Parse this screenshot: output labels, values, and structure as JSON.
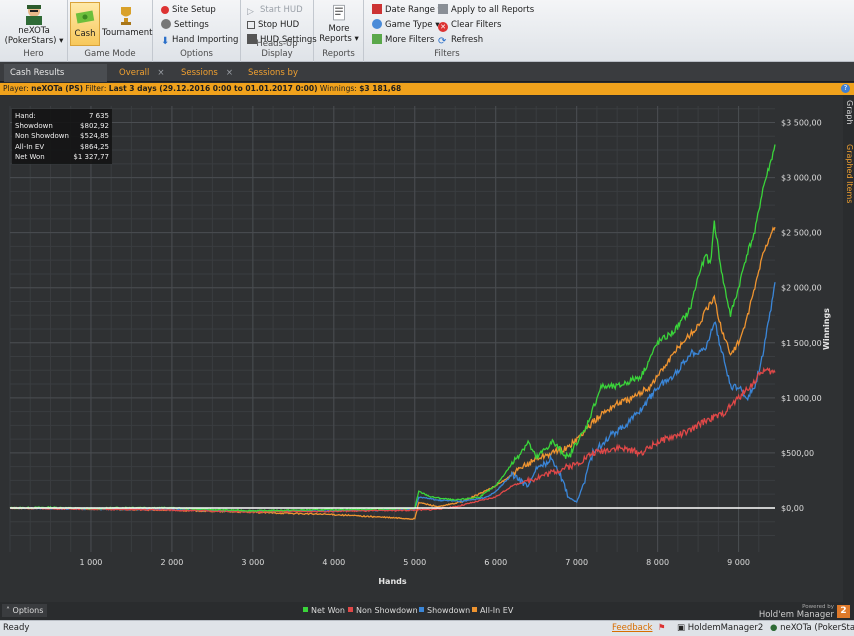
{
  "ribbon": {
    "hero": {
      "name": "neXOTa",
      "site": "(PokerStars)",
      "group_label": "Hero"
    },
    "game_mode": {
      "cash": "Cash",
      "tournament": "Tournament",
      "group_label": "Game Mode"
    },
    "options": {
      "site_setup": "Site Setup",
      "settings": "Settings",
      "hand_importing": "Hand Importing",
      "group_label": "Options"
    },
    "hud": {
      "start": "Start HUD",
      "stop": "Stop HUD",
      "settings": "HUD Settings",
      "group_label": "Heads-Up Display"
    },
    "reports": {
      "more_line1": "More",
      "more_line2": "Reports",
      "group_label": "Reports"
    },
    "filters": {
      "date_range": "Date Range",
      "game_type": "Game Type",
      "more_filters": "More Filters",
      "apply_all": "Apply to all Reports",
      "clear": "Clear Filters",
      "refresh": "Refresh",
      "group_label": "Filters"
    }
  },
  "tabs": [
    {
      "label": "Cash Results Graph"
    },
    {
      "label": "Overall"
    },
    {
      "label": "Sessions"
    },
    {
      "label": "Sessions by Day"
    }
  ],
  "filter_bar": {
    "player_label": "Player:",
    "player": "neXOTa (PS)",
    "filter_label": "Filter:",
    "filter": "Last 3 days (29.12.2016 0:00 to 01.01.2017 0:00)",
    "winnings_label": "Winnings:",
    "winnings": "$3 181,68",
    "help": "?"
  },
  "side_tabs": {
    "graph": "Graph",
    "graphed_items": "Graphed Items"
  },
  "stats": [
    {
      "label": "Hand:",
      "value": "7 635"
    },
    {
      "label": "Showdown",
      "value": "$802,92"
    },
    {
      "label": "Non Showdown",
      "value": "$524,85"
    },
    {
      "label": "All-In EV",
      "value": "$864,25"
    },
    {
      "label": "Net Won",
      "value": "$1 327,77"
    }
  ],
  "chart_data": {
    "type": "line",
    "xlabel": "Hands",
    "ylabel": "Winnings",
    "xlim": [
      0,
      9450
    ],
    "ylim": [
      -400,
      3650
    ],
    "x_ticks": [
      "1 000",
      "2 000",
      "3 000",
      "4 000",
      "5 000",
      "6 000",
      "7 000",
      "8 000",
      "9 000"
    ],
    "y_ticks": [
      "$0,00",
      "$500,00",
      "$1 000,00",
      "$1 500,00",
      "$2 000,00",
      "$2 500,00",
      "$3 000,00",
      "$3 500,00"
    ],
    "grid": true,
    "legend_position": "bottom",
    "series": [
      {
        "name": "Net Won",
        "color": "#3ad43a",
        "points": [
          [
            0,
            0
          ],
          [
            500,
            5
          ],
          [
            1000,
            -5
          ],
          [
            1500,
            5
          ],
          [
            2000,
            0
          ],
          [
            2500,
            -15
          ],
          [
            3000,
            -25
          ],
          [
            3500,
            -20
          ],
          [
            4000,
            -15
          ],
          [
            4500,
            -10
          ],
          [
            5000,
            -5
          ],
          [
            5050,
            150
          ],
          [
            5200,
            100
          ],
          [
            5500,
            70
          ],
          [
            5800,
            100
          ],
          [
            6000,
            200
          ],
          [
            6200,
            400
          ],
          [
            6400,
            600
          ],
          [
            6500,
            450
          ],
          [
            6700,
            600
          ],
          [
            6900,
            450
          ],
          [
            7000,
            600
          ],
          [
            7100,
            700
          ],
          [
            7200,
            900
          ],
          [
            7300,
            1100
          ],
          [
            7500,
            1100
          ],
          [
            7800,
            1200
          ],
          [
            8000,
            1500
          ],
          [
            8200,
            1600
          ],
          [
            8400,
            1800
          ],
          [
            8500,
            2100
          ],
          [
            8600,
            2300
          ],
          [
            8650,
            2200
          ],
          [
            8700,
            2600
          ],
          [
            8800,
            2100
          ],
          [
            8900,
            1750
          ],
          [
            9000,
            2000
          ],
          [
            9100,
            2300
          ],
          [
            9200,
            2500
          ],
          [
            9300,
            2900
          ],
          [
            9400,
            3150
          ],
          [
            9450,
            3300
          ]
        ]
      },
      {
        "name": "Non Showdown",
        "color": "#e04848",
        "points": [
          [
            0,
            0
          ],
          [
            1000,
            -10
          ],
          [
            2000,
            -20
          ],
          [
            3000,
            -35
          ],
          [
            4000,
            -30
          ],
          [
            5000,
            -20
          ],
          [
            5200,
            -15
          ],
          [
            5500,
            10
          ],
          [
            6000,
            100
          ],
          [
            6200,
            200
          ],
          [
            6400,
            250
          ],
          [
            6600,
            300
          ],
          [
            6800,
            350
          ],
          [
            7000,
            400
          ],
          [
            7200,
            500
          ],
          [
            7500,
            550
          ],
          [
            7800,
            500
          ],
          [
            8000,
            600
          ],
          [
            8200,
            650
          ],
          [
            8400,
            700
          ],
          [
            8600,
            800
          ],
          [
            8800,
            850
          ],
          [
            9000,
            1000
          ],
          [
            9200,
            1150
          ],
          [
            9300,
            1250
          ],
          [
            9450,
            1230
          ]
        ]
      },
      {
        "name": "Showdown",
        "color": "#3a86d8",
        "points": [
          [
            0,
            0
          ],
          [
            1000,
            -10
          ],
          [
            2000,
            -15
          ],
          [
            3000,
            -30
          ],
          [
            4000,
            -25
          ],
          [
            5000,
            -15
          ],
          [
            5050,
            100
          ],
          [
            5300,
            70
          ],
          [
            5600,
            60
          ],
          [
            5900,
            100
          ],
          [
            6000,
            150
          ],
          [
            6200,
            300
          ],
          [
            6400,
            200
          ],
          [
            6500,
            350
          ],
          [
            6700,
            450
          ],
          [
            6800,
            300
          ],
          [
            6900,
            100
          ],
          [
            7000,
            50
          ],
          [
            7100,
            250
          ],
          [
            7200,
            500
          ],
          [
            7400,
            650
          ],
          [
            7600,
            750
          ],
          [
            7800,
            900
          ],
          [
            8000,
            1100
          ],
          [
            8200,
            1200
          ],
          [
            8400,
            1400
          ],
          [
            8600,
            1450
          ],
          [
            8700,
            1700
          ],
          [
            8800,
            1400
          ],
          [
            8900,
            1100
          ],
          [
            9000,
            1100
          ],
          [
            9100,
            1000
          ],
          [
            9200,
            1100
          ],
          [
            9300,
            1400
          ],
          [
            9400,
            1800
          ],
          [
            9450,
            2050
          ]
        ]
      },
      {
        "name": "All-In EV",
        "color": "#ef9430",
        "points": [
          [
            0,
            0
          ],
          [
            1000,
            -10
          ],
          [
            2000,
            -20
          ],
          [
            3000,
            -40
          ],
          [
            4000,
            -60
          ],
          [
            5000,
            -100
          ],
          [
            5050,
            50
          ],
          [
            5300,
            10
          ],
          [
            5600,
            60
          ],
          [
            6000,
            200
          ],
          [
            6200,
            300
          ],
          [
            6500,
            450
          ],
          [
            6700,
            500
          ],
          [
            6900,
            550
          ],
          [
            7100,
            700
          ],
          [
            7300,
            850
          ],
          [
            7500,
            950
          ],
          [
            7700,
            1000
          ],
          [
            7900,
            1100
          ],
          [
            8100,
            1300
          ],
          [
            8300,
            1500
          ],
          [
            8500,
            1650
          ],
          [
            8600,
            1800
          ],
          [
            8700,
            1900
          ],
          [
            8800,
            1600
          ],
          [
            8900,
            1400
          ],
          [
            9000,
            1500
          ],
          [
            9100,
            1700
          ],
          [
            9200,
            2000
          ],
          [
            9300,
            2300
          ],
          [
            9400,
            2500
          ],
          [
            9450,
            2550
          ]
        ]
      }
    ]
  },
  "legend": [
    {
      "name": "Net Won",
      "color": "#3ad43a"
    },
    {
      "name": "Non Showdown",
      "color": "#e04848"
    },
    {
      "name": "Showdown",
      "color": "#3a86d8"
    },
    {
      "name": "All-In EV",
      "color": "#ef9430"
    }
  ],
  "bottom": {
    "options": "Options",
    "powered_by": "Powered by",
    "brand": "Hold'em Manager",
    "brand_badge": "2"
  },
  "statusbar": {
    "ready": "Ready",
    "feedback": "Feedback",
    "app": "HoldemManager2",
    "hero": "neXOTa (PokerStars)"
  }
}
